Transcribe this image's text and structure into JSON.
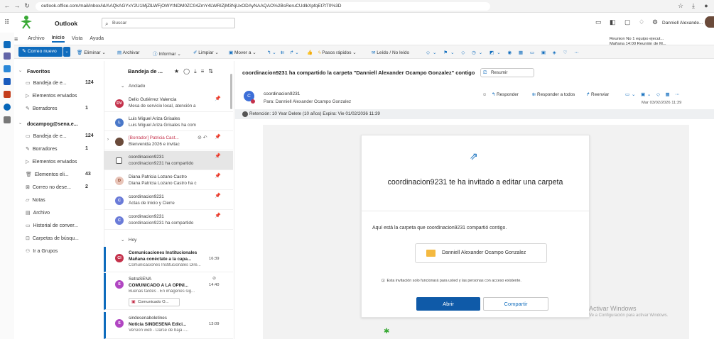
{
  "browser": {
    "url": "outlook.office.com/mail/inbox/id/AAQkAGYxY2U1MjZlLWFjOWYtNDM0ZC04ZmY4LWRlZjM3NjUxODAyNAAQAO%2BsReruCUdlkXpfqEt7tT0%3D"
  },
  "header": {
    "app": "Outlook",
    "search_placeholder": "Buscar",
    "user": "Danniell Alexande..."
  },
  "menu": {
    "tabs": [
      "Archivo",
      "Inicio",
      "Vista",
      "Ayuda"
    ],
    "active": "Inicio"
  },
  "ribbon": {
    "new_mail": "Correo nuevo",
    "delete": "Eliminar",
    "archive": "Archivar",
    "report": "Informar",
    "clean": "Limpiar",
    "move": "Mover a",
    "quick_steps": "Pasos rápidos",
    "read_unread": "Leído / No leído"
  },
  "meeting": {
    "line1": "Reunion No 1 equipo ejecut...",
    "line2": "Mañana 14:00 Reunión de M..."
  },
  "folders": {
    "favorites_title": "Favoritos",
    "favorites": [
      {
        "label": "Bandeja de e...",
        "count": "124"
      },
      {
        "label": "Elementos enviados",
        "count": ""
      },
      {
        "label": "Borradores",
        "count": "1"
      }
    ],
    "account_title": "docampog@sena.e...",
    "account": [
      {
        "label": "Bandeja de e...",
        "count": "124"
      },
      {
        "label": "Borradores",
        "count": "1"
      },
      {
        "label": "Elementos enviados",
        "count": ""
      },
      {
        "label": "Elementos eli...",
        "count": "43"
      },
      {
        "label": "Correo no dese...",
        "count": "2"
      },
      {
        "label": "Notas",
        "count": ""
      },
      {
        "label": "Archivo",
        "count": ""
      },
      {
        "label": "Historial de conver...",
        "count": ""
      },
      {
        "label": "Carpetas de búsqu...",
        "count": ""
      }
    ],
    "groups": "Ir a Grupos"
  },
  "list": {
    "title": "Bandeja de ...",
    "pinned_section": "Anclado",
    "today_section": "Hoy",
    "messages": [
      {
        "initials": "DV",
        "from": "Delio Gutiérrez Valencia",
        "subject": "Mesa de servicio local, atención a",
        "color": "#c4314b"
      },
      {
        "initials": "L",
        "from": "Luis Miguel Ariza Grisales",
        "subject": "Luis Miguel Ariza Grisales ha com",
        "color": "#4a78c9"
      },
      {
        "initials": "",
        "from": "[Borrador] Patricia Cast...",
        "subject": "Bienvenida 2026 e invitac",
        "color": "#6a4a3a"
      },
      {
        "initials": "",
        "from": "coordinacion9231",
        "subject": "coordinacion9231 ha compartido",
        "color": "#ffffff"
      },
      {
        "initials": "D",
        "from": "Diana Patricia Lozano Castro",
        "subject": "Diana Patricia Lozano Castro ha c",
        "color": "#d06a50"
      },
      {
        "initials": "C",
        "from": "coordinacion9231",
        "subject": "Actas de Inicio y Cierre",
        "color": "#6a7bd8"
      },
      {
        "initials": "C",
        "from": "coordinacion9231",
        "subject": "coordinacion9231 ha compartido",
        "color": "#6a7bd8"
      },
      {
        "initials": "CI",
        "from": "Comunicaciones Institucionales",
        "subject": "Mañana conéctate a la capa...",
        "time": "16:39",
        "preview": "Comunicaciones Institucionales Dire...",
        "color": "#c4314b"
      },
      {
        "initials": "S",
        "from": "SetraSENA",
        "subject": "COMUNICADO A LA OPINI...",
        "time": "14:40",
        "preview": "Buenas tardes . En imágenes sig...",
        "attachment": "Comunicado O...",
        "color": "#b146c2"
      },
      {
        "initials": "S",
        "from": "sindesenaboletines",
        "subject": "Noticia SINDESENA Edici...",
        "time": "13:09",
        "preview": "Version web - Darse de baja -...",
        "color": "#b146c2"
      }
    ]
  },
  "reading": {
    "subject": "coordinacion9231 ha compartido la carpeta \"Danniell Alexander Ocampo Gonzalez\" contigo",
    "summarize": "Resumir",
    "sender": "coordinacion9231",
    "sender_initial": "C",
    "to": "Para:  Danniell Alexander Ocampo Gonzalez",
    "reply": "Responder",
    "reply_all": "Responder a todos",
    "forward": "Reenviar",
    "date": "Mar 03/02/2026 11:39",
    "retention": "Retención: 10 Year Delete (10 años) Expira: Vie 01/02/2036 11:39",
    "card_title": "coordinacion9231 te ha invitado a editar una carpeta",
    "card_text": "Aquí está la carpeta que coordinacion9231 compartió contigo.",
    "folder_name": "Danniell Alexander Ocampo Gonzalez",
    "note": "Esta invitación solo funcionará para usted y las personas con acceso existente.",
    "open": "Abrir",
    "share": "Compartir"
  },
  "watermark": {
    "line1": "Activar Windows",
    "line2": "Ve a Configuración para activar Windows."
  },
  "colors": {
    "accent": "#0f6cbd",
    "sena_green": "#39a935"
  }
}
